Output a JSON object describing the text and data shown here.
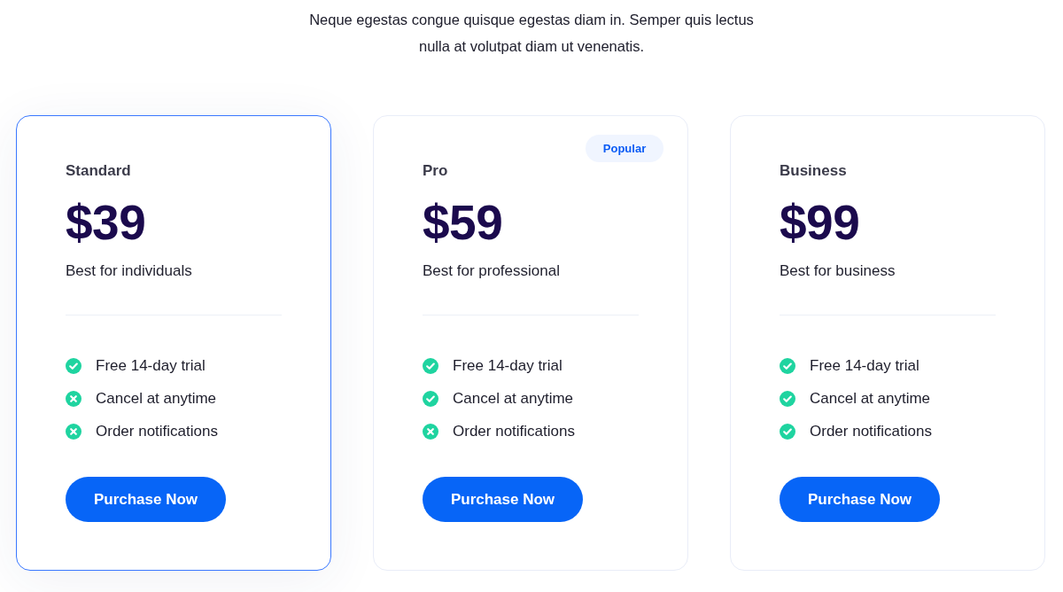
{
  "intro": {
    "text": "Neque egestas congue quisque egestas diam in. Semper quis lectus nulla at volutpat diam ut venenatis."
  },
  "plans": [
    {
      "name": "Standard",
      "price": "$39",
      "tagline": "Best for individuals",
      "selected": true,
      "features": [
        {
          "label": "Free 14-day trial",
          "included": true
        },
        {
          "label": "Cancel at anytime",
          "included": false
        },
        {
          "label": "Order notifications",
          "included": false
        }
      ],
      "button": "Purchase Now"
    },
    {
      "name": "Pro",
      "badge": "Popular",
      "price": "$59",
      "tagline": "Best for professional",
      "selected": false,
      "features": [
        {
          "label": "Free 14-day trial",
          "included": true
        },
        {
          "label": "Cancel at anytime",
          "included": true
        },
        {
          "label": "Order notifications",
          "included": false
        }
      ],
      "button": "Purchase Now"
    },
    {
      "name": "Business",
      "price": "$99",
      "tagline": "Best for business",
      "selected": false,
      "features": [
        {
          "label": "Free 14-day trial",
          "included": true
        },
        {
          "label": "Cancel at anytime",
          "included": true
        },
        {
          "label": "Order notifications",
          "included": true
        }
      ],
      "button": "Purchase Now"
    }
  ]
}
